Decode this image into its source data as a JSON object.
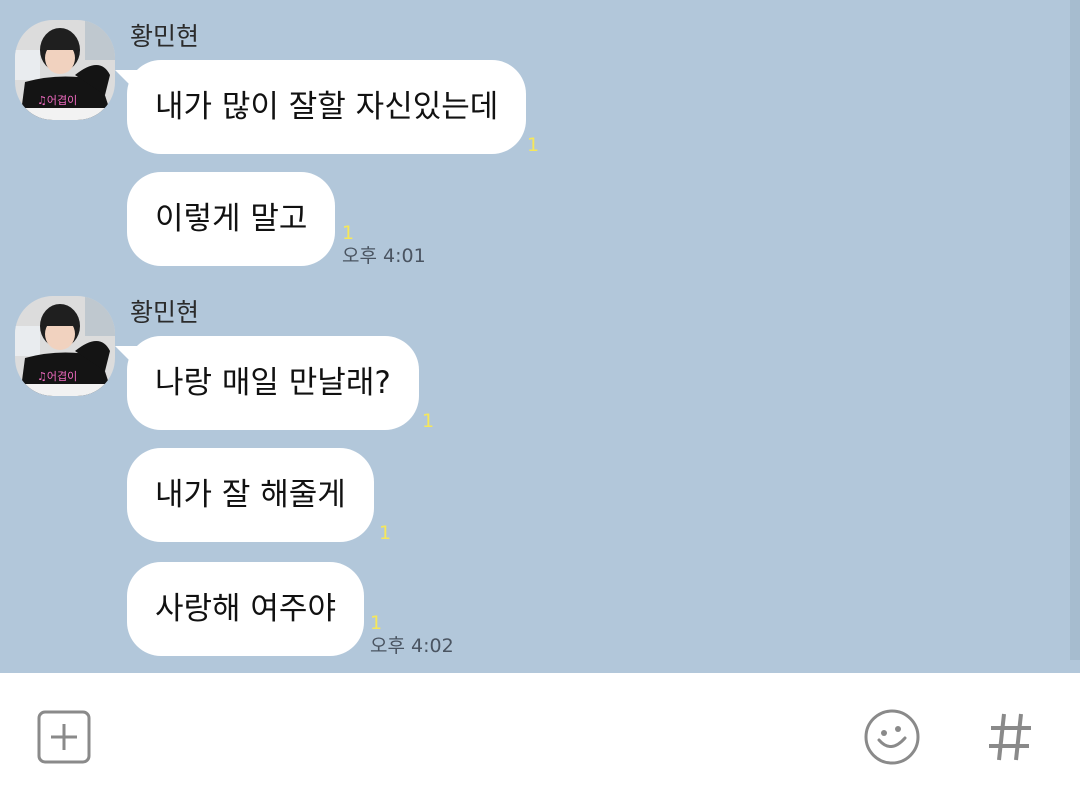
{
  "messages": [
    {
      "sender": "황민현",
      "bubbles": [
        {
          "text": "내가 많이 잘할 자신있는데",
          "unread": "1"
        },
        {
          "text": "이렇게 말고",
          "unread": "1",
          "time": "오후 4:01"
        }
      ]
    },
    {
      "sender": "황민현",
      "bubbles": [
        {
          "text": "나랑 매일 만날래?",
          "unread": "1"
        },
        {
          "text": "내가 잘 해줄게",
          "unread": "1"
        },
        {
          "text": "사랑해 여주야",
          "unread": "1",
          "time": "오후 4:02"
        }
      ]
    }
  ],
  "input_bar": {
    "add_icon": "plus-square-icon",
    "emoji_icon": "smiley-icon",
    "hashtag_icon": "hashtag-icon"
  },
  "colors": {
    "chat_background": "#b2c7da",
    "bubble": "#ffffff",
    "unread": "#f6e75a",
    "icon_gray": "#8a8a8a"
  }
}
